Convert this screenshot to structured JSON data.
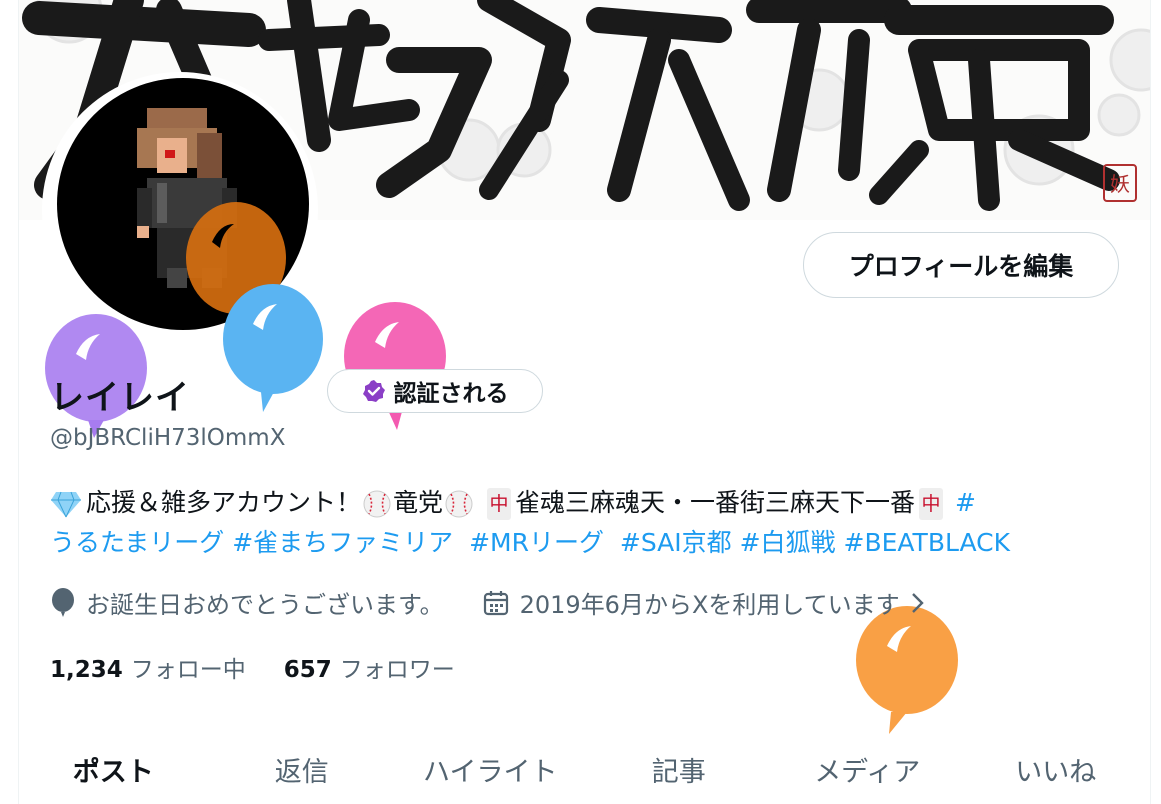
{
  "banner": {
    "calligraphy": "大極新腹",
    "seal": "妖"
  },
  "profile": {
    "edit_button": "プロフィールを編集",
    "display_name": "レイレイ",
    "verify_button": "認証される",
    "handle": "@bJBRCliH73lOmmX"
  },
  "bio": {
    "part1": "応援＆雑多アカウント！",
    "part2": "竜党",
    "mahjong_tile": "中",
    "part3": "雀魂三麻魂天・一番街三麻天下一番",
    "tag_hash": "#",
    "tag1": "うるたまリーグ",
    "tag2": "#雀まちファミリア",
    "tag3": "#MRリーグ",
    "tag4": "#SAI京都",
    "tag5": "#白狐戦",
    "tag6": "#BEATBLACK"
  },
  "meta": {
    "location": "お誕生日おめでとうございます。",
    "joined": "2019年6月からXを利用しています"
  },
  "stats": {
    "following_count": "1,234",
    "following_label": "フォロー中",
    "followers_count": "657",
    "followers_label": "フォロワー"
  },
  "tabs": [
    "ポスト",
    "返信",
    "ハイライト",
    "記事",
    "メディア",
    "いいね"
  ],
  "colors": {
    "accent": "#1d9bf0",
    "balloon_purple": "#a77cf0",
    "balloon_blue": "#5ab4f2",
    "balloon_pink": "#f35ab0",
    "balloon_orange": "#f9a045",
    "balloon_dark_orange": "#d9700f"
  }
}
